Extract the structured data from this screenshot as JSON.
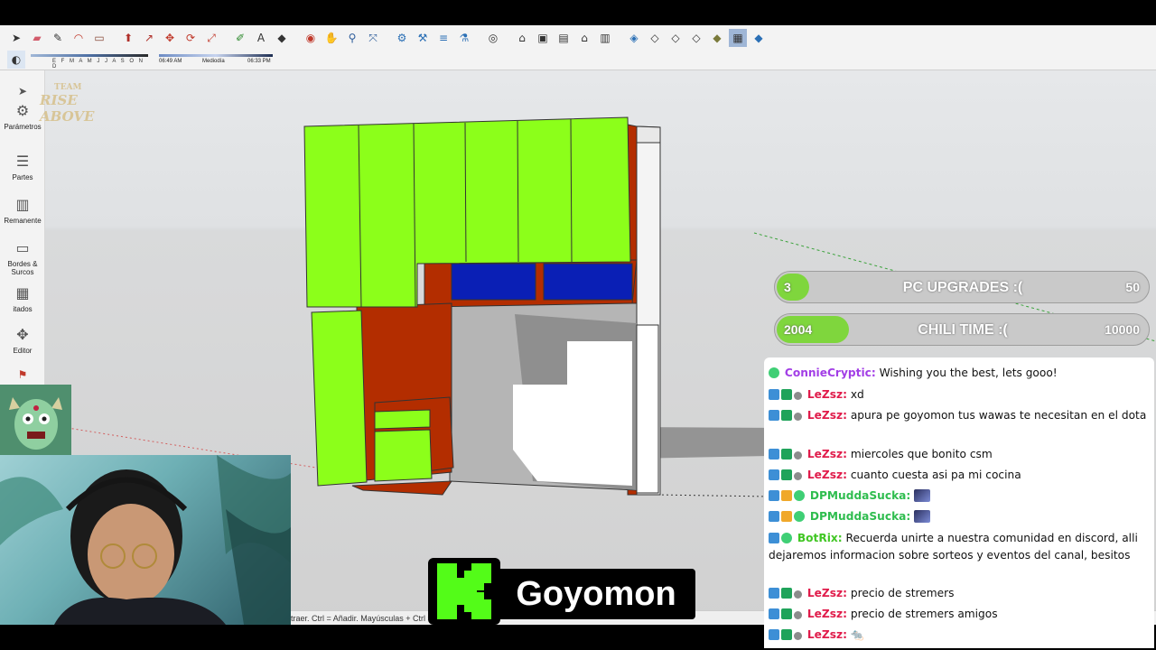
{
  "toolbar": {
    "months": "E F M A M J J A S O N D",
    "time_start": "06:49 AM",
    "time_mid": "Mediodía",
    "time_end": "06:33 PM"
  },
  "sidebar": {
    "items": [
      {
        "label": "Parámetros"
      },
      {
        "label": "Partes"
      },
      {
        "label": "Remanente"
      },
      {
        "label": "Bordes & Surcos"
      },
      {
        "label": "itados"
      },
      {
        "label": "Editor"
      }
    ]
  },
  "logo": {
    "line1": "TEAM",
    "line2": "RISE ABOVE"
  },
  "statusbar": {
    "text": "traer. Ctrl = Añadir. Mayúsculas + Ctrl ="
  },
  "brand": {
    "name": "Goyomon"
  },
  "goals": [
    {
      "current": "3",
      "title": "PC UPGRADES :(",
      "target": "50",
      "progress": 0.06
    },
    {
      "current": "2004",
      "title": "CHILI TIME :(",
      "target": "10000",
      "progress": 0.2
    }
  ],
  "chat": [
    {
      "user": "ConnieCryptic:",
      "text": "Wishing you the best, lets gooo!"
    },
    {
      "user": "LeZsz:",
      "text": "xd"
    },
    {
      "user": "LeZsz:",
      "text": "apura pe goyomon tus wawas te necesitan en el dota"
    },
    {
      "user": "LeZsz:",
      "text": "miercoles que bonito csm"
    },
    {
      "user": "LeZsz:",
      "text": "cuanto cuesta asi pa mi cocina"
    },
    {
      "user": "DPMuddaSucka:",
      "text": ""
    },
    {
      "user": "DPMuddaSucka:",
      "text": ""
    },
    {
      "user": "BotRix:",
      "text": "Recuerda unirte a nuestra comunidad en discord, alli dejaremos informacion sobre sorteos y eventos del canal, besitos"
    },
    {
      "user": "LeZsz:",
      "text": "precio de stremers"
    },
    {
      "user": "LeZsz:",
      "text": "precio de stremers amigos"
    },
    {
      "user": "LeZsz:",
      "text": ""
    }
  ],
  "colors": {
    "cabinet_door": "#8cff1a",
    "carcass": "#b32d00",
    "glass_panel": "#0a1fb5",
    "goal_fill": "#7fd63d",
    "kick_brand": "#53fc18"
  }
}
